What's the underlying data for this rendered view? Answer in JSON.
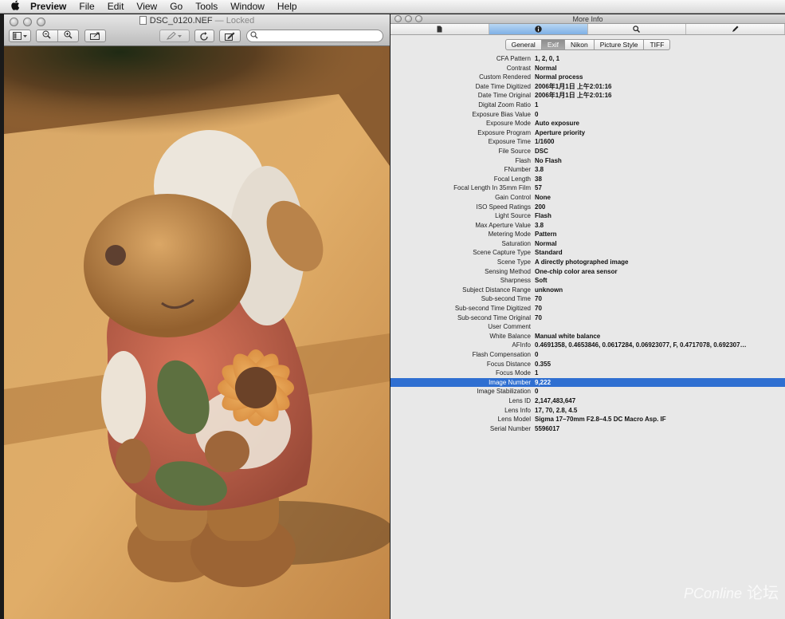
{
  "menubar": {
    "apple": "",
    "app": "Preview",
    "items": [
      "File",
      "Edit",
      "View",
      "Go",
      "Tools",
      "Window",
      "Help"
    ]
  },
  "preview": {
    "filename": "DSC_0120.NEF",
    "separator": " — ",
    "status": "Locked",
    "search_placeholder": ""
  },
  "info": {
    "title": "More Info",
    "tabs": [
      "General",
      "Exif",
      "Nikon",
      "Picture Style",
      "TIFF"
    ],
    "active_tab": "Exif",
    "selected_row": "Image Number",
    "rows": [
      {
        "k": "CFA Pattern",
        "v": "1, 2, 0, 1"
      },
      {
        "k": "Contrast",
        "v": "Normal"
      },
      {
        "k": "Custom Rendered",
        "v": "Normal process"
      },
      {
        "k": "Date Time Digitized",
        "v": "2006年1月1日 上午2:01:16"
      },
      {
        "k": "Date Time Original",
        "v": "2006年1月1日 上午2:01:16"
      },
      {
        "k": "Digital Zoom Ratio",
        "v": "1"
      },
      {
        "k": "Exposure Bias Value",
        "v": "0"
      },
      {
        "k": "Exposure Mode",
        "v": "Auto exposure"
      },
      {
        "k": "Exposure Program",
        "v": "Aperture priority"
      },
      {
        "k": "Exposure Time",
        "v": "1/1600"
      },
      {
        "k": "File Source",
        "v": "DSC"
      },
      {
        "k": "Flash",
        "v": "No Flash"
      },
      {
        "k": "FNumber",
        "v": "3.8"
      },
      {
        "k": "Focal Length",
        "v": "38"
      },
      {
        "k": "Focal Length In 35mm Film",
        "v": "57"
      },
      {
        "k": "Gain Control",
        "v": "None"
      },
      {
        "k": "ISO Speed Ratings",
        "v": "200"
      },
      {
        "k": "Light Source",
        "v": "Flash"
      },
      {
        "k": "Max Aperture Value",
        "v": "3.8"
      },
      {
        "k": "Metering Mode",
        "v": "Pattern"
      },
      {
        "k": "Saturation",
        "v": "Normal"
      },
      {
        "k": "Scene Capture Type",
        "v": "Standard"
      },
      {
        "k": "Scene Type",
        "v": "A directly photographed image"
      },
      {
        "k": "Sensing Method",
        "v": "One-chip color area sensor"
      },
      {
        "k": "Sharpness",
        "v": "Soft"
      },
      {
        "k": "Subject Distance Range",
        "v": "unknown"
      },
      {
        "k": "Sub-second Time",
        "v": "70"
      },
      {
        "k": "Sub-second Time Digitized",
        "v": "70"
      },
      {
        "k": "Sub-second Time Original",
        "v": "70"
      },
      {
        "k": "User Comment",
        "v": ""
      },
      {
        "k": "White Balance",
        "v": "Manual white balance"
      },
      {
        "k": "AFInfo",
        "v": "0.4691358, 0.4653846, 0.0617284, 0.06923077, F, 0.4717078, 0.692307…"
      },
      {
        "k": "Flash Compensation",
        "v": "0"
      },
      {
        "k": "Focus Distance",
        "v": "0.355"
      },
      {
        "k": "Focus Mode",
        "v": "1"
      },
      {
        "k": "Image Number",
        "v": "9,222"
      },
      {
        "k": "Image Stabilization",
        "v": "0"
      },
      {
        "k": "Lens ID",
        "v": "2,147,483,647"
      },
      {
        "k": "Lens Info",
        "v": "17, 70, 2.8, 4.5"
      },
      {
        "k": "Lens Model",
        "v": "Sigma 17–70mm F2.8–4.5 DC Macro Asp. IF"
      },
      {
        "k": "Serial Number",
        "v": "5596017"
      }
    ]
  },
  "watermark": {
    "brand": "PConline",
    "cn": "论坛"
  },
  "colors": {
    "selection": "#2f6fd1",
    "segment_active": "#7eb0e6"
  }
}
